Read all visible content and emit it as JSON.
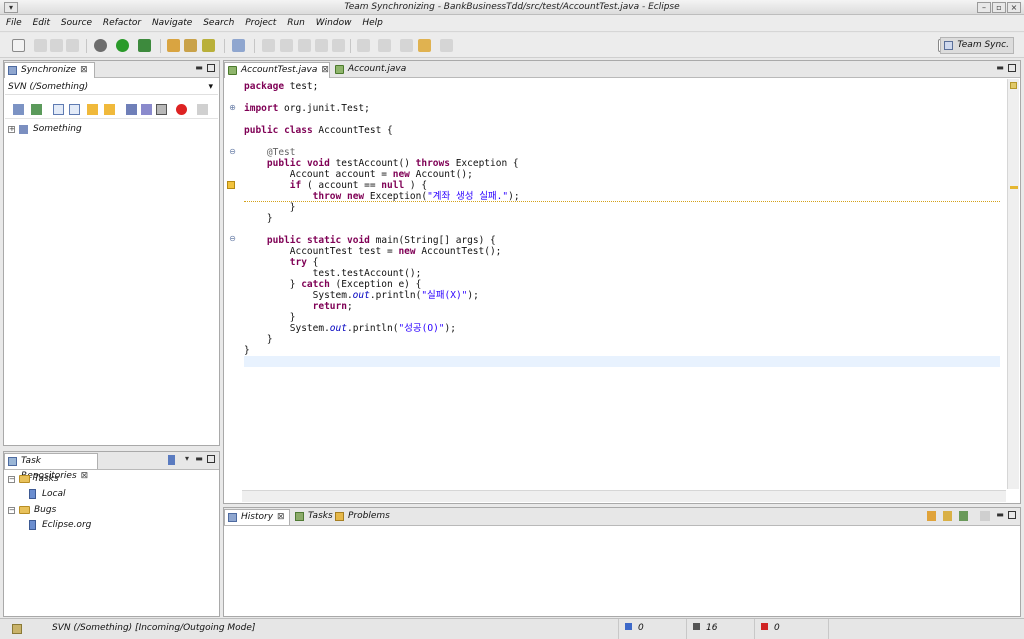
{
  "window": {
    "title": "Team Synchronizing - BankBusinessTdd/src/test/AccountTest.java - Eclipse"
  },
  "menu": [
    "File",
    "Edit",
    "Source",
    "Refactor",
    "Navigate",
    "Search",
    "Project",
    "Run",
    "Window",
    "Help"
  ],
  "perspective": {
    "label": "Team Sync."
  },
  "sync_view": {
    "tab_label": "Synchronize",
    "svn_label": "SVN (/Something)",
    "tree": [
      {
        "label": "Something"
      }
    ]
  },
  "task_view": {
    "tab_label": "Task Repositories",
    "groups": [
      {
        "label": "Tasks",
        "children": [
          "Local"
        ]
      },
      {
        "label": "Bugs",
        "children": [
          "Eclipse.org"
        ]
      }
    ]
  },
  "editor": {
    "tabs": [
      {
        "label": "AccountTest.java",
        "active": true
      },
      {
        "label": "Account.java",
        "active": false
      }
    ],
    "lines": [
      "package test;",
      "",
      "import org.junit.Test;",
      "",
      "public class AccountTest {",
      "",
      "    @Test",
      "    public void testAccount() throws Exception {",
      "        Account account = new Account();",
      "        if ( account == null ) {",
      "            throw new Exception(\"계좌 생성 실패.\");",
      "        }",
      "    }",
      "",
      "    public static void main(String[] args) {",
      "        AccountTest test = new AccountTest();",
      "        try {",
      "            test.testAccount();",
      "        } catch (Exception e) {",
      "            System.out.println(\"실패(X)\");",
      "            return;",
      "        }",
      "        System.out.println(\"성공(O)\");",
      "    }",
      "}"
    ]
  },
  "bottom_view": {
    "tabs": [
      {
        "label": "History",
        "active": true
      },
      {
        "label": "Tasks",
        "active": false
      },
      {
        "label": "Problems",
        "active": false
      }
    ]
  },
  "status": {
    "mode_text": "SVN (/Something) [Incoming/Outgoing Mode]",
    "incoming": "0",
    "outgoing": "16",
    "conflicts": "0"
  },
  "colors": {
    "keyword": "#7f0055",
    "string": "#2a00ff",
    "annotation": "#646464",
    "field": "#0000c0"
  }
}
